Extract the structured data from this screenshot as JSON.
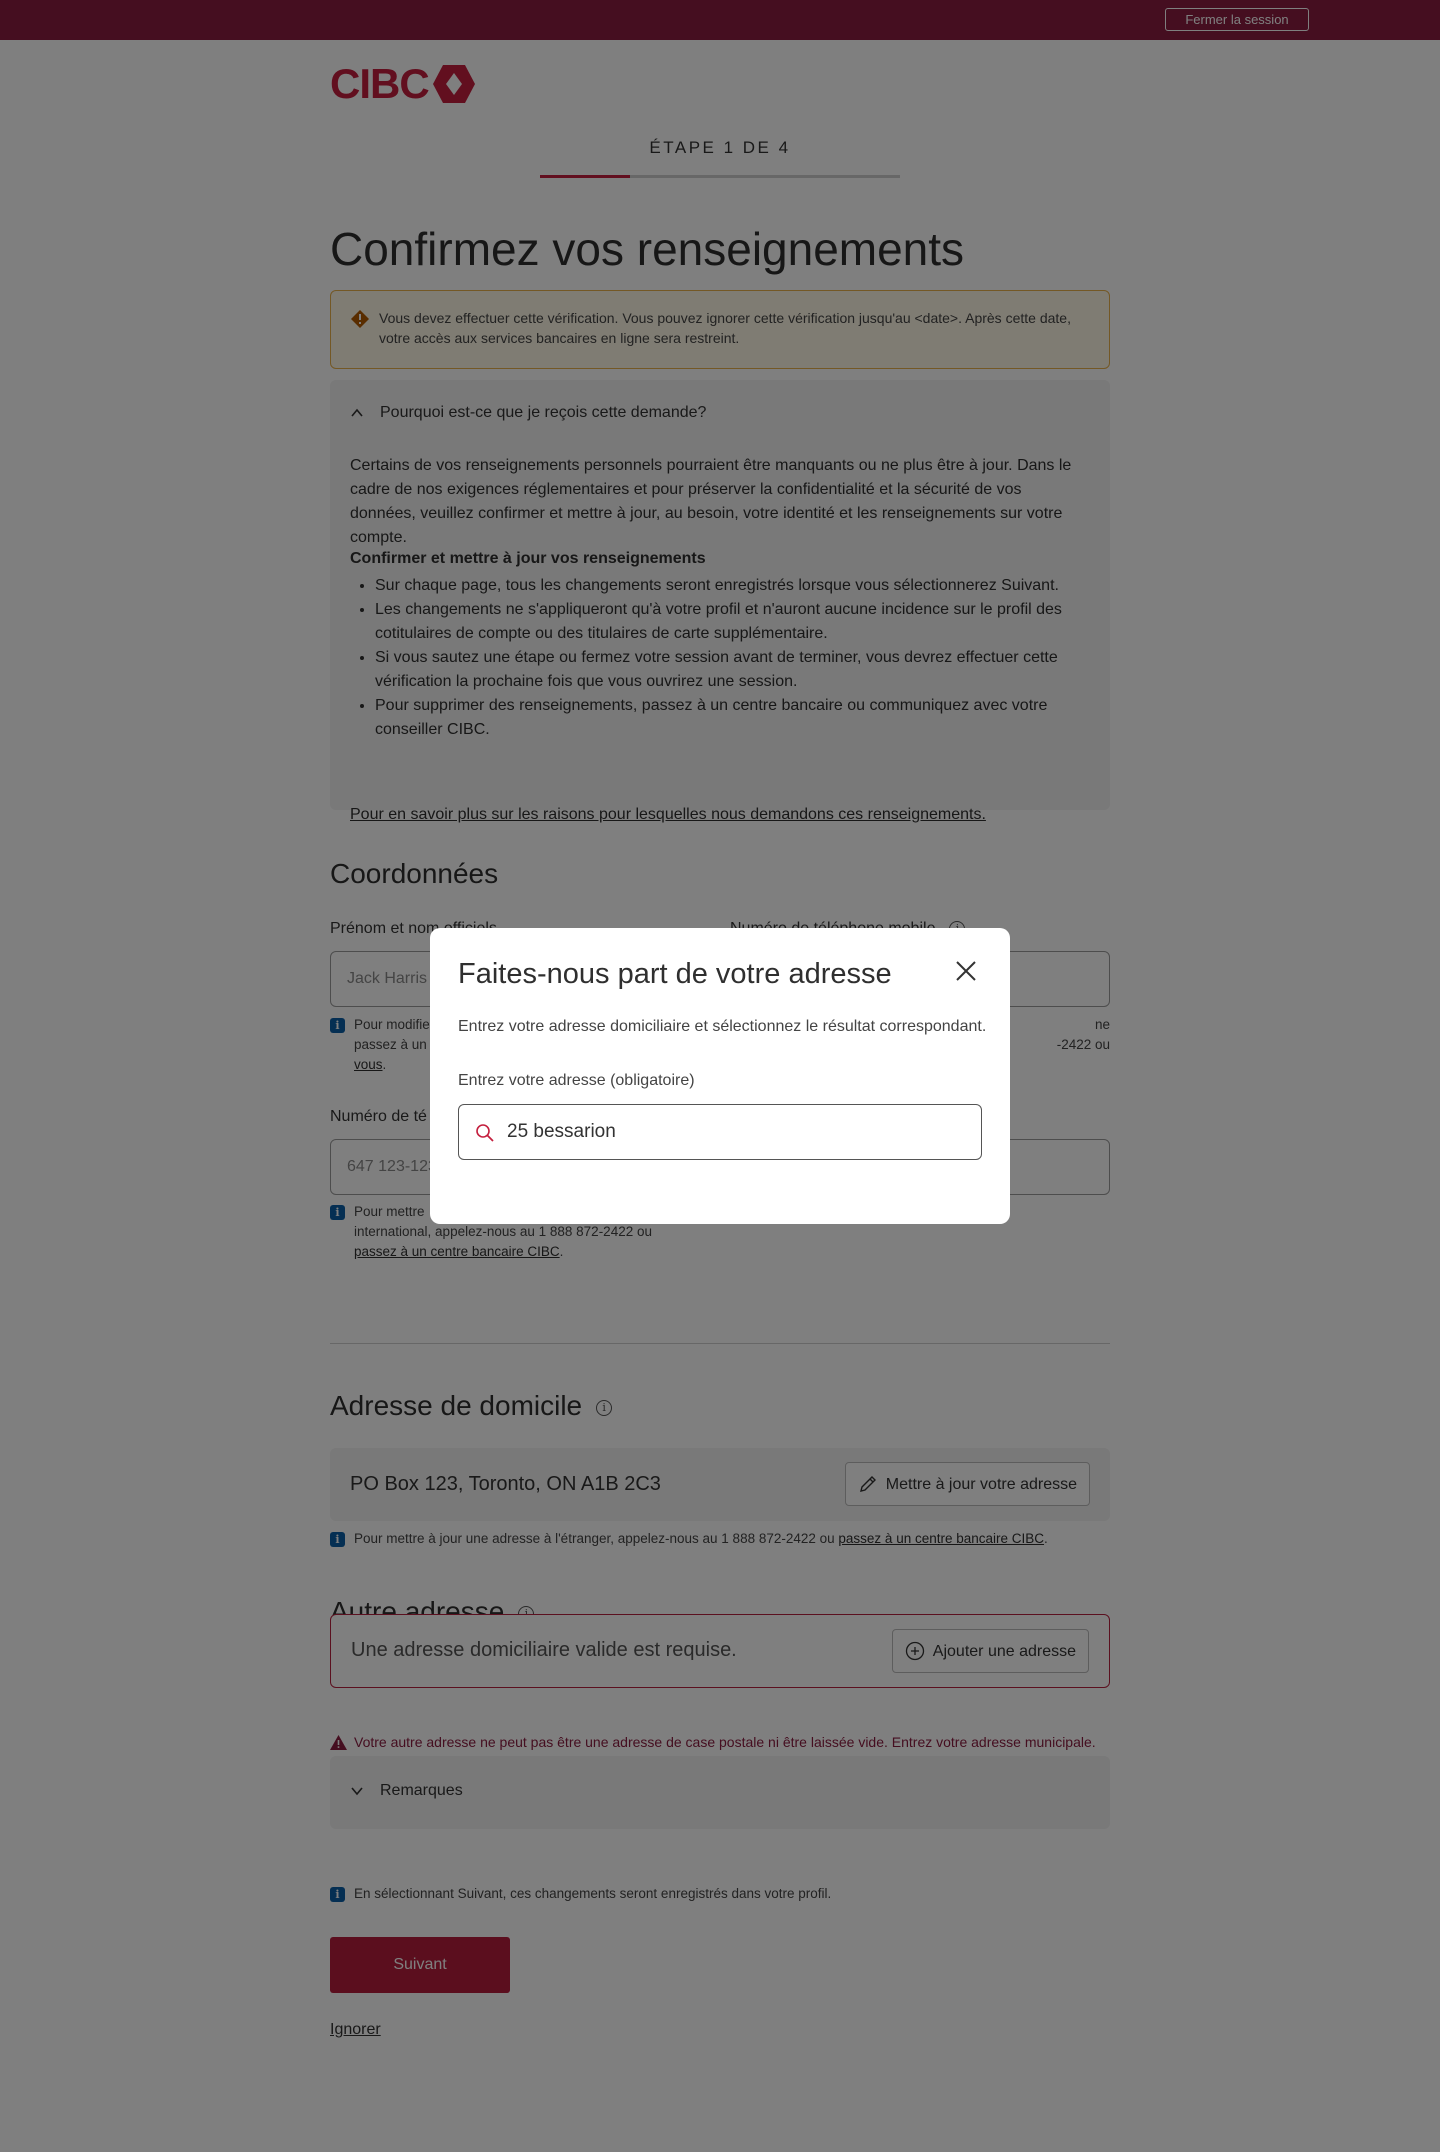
{
  "header": {
    "logout_label": "Fermer la session"
  },
  "brand": {
    "logo_text": "CIBC",
    "accent_color": "#c41f3e",
    "topbar_color": "#8b1d41"
  },
  "progress": {
    "step_label": "ÉTAPE 1 DE 4",
    "fraction": 0.25
  },
  "page": {
    "title": "Confirmez vos renseignements"
  },
  "warning": {
    "text": "Vous devez effectuer cette vérification. Vous pouvez ignorer cette vérification jusqu'au <date>. Après cette date, votre accès aux services bancaires en ligne sera restreint."
  },
  "why": {
    "heading": "Pourquoi est-ce que je reçois cette demande?",
    "paragraph": "Certains de vos renseignements personnels pourraient être manquants ou ne plus être à jour. Dans le cadre de nos exigences réglementaires et pour préserver la confidentialité et la sécurité de vos données, veuillez confirmer et mettre à jour, au besoin, votre identité et les renseignements sur votre compte.",
    "subheading": "Confirmer et mettre à jour vos renseignements",
    "bullets": [
      "Sur chaque page, tous les changements seront enregistrés lorsque vous sélectionnerez Suivant.",
      "Les changements ne s'appliqueront qu'à votre profil et n'auront aucune incidence sur le profil des cotitulaires de compte ou des titulaires de carte supplémentaire.",
      "Si vous sautez une étape ou fermez votre session avant de terminer, vous devrez effectuer cette vérification la prochaine fois que vous ouvrirez une session.",
      "Pour supprimer des renseignements, passez à un centre bancaire ou communiquez avec votre conseiller CIBC."
    ],
    "link": "Pour en savoir plus sur les raisons pour lesquelles nous demandons ces renseignements."
  },
  "contact": {
    "title": "Coordonnées",
    "name_label": "Prénom et nom officiels",
    "name_value": "Jack Harris",
    "name_help_a": "Pour modifier",
    "name_help_b": "passez à un",
    "name_help_c": "vous",
    "mobile_label": "Numéro de téléphone mobile",
    "mobile_help_a": "ne",
    "mobile_help_b": "-2422 ou",
    "phone_label": "Numéro de té",
    "phone_value": "647 123-123",
    "phone_help_a": "Pour mettre",
    "phone_help_b": "international, appelez-nous au 1 888 872-2422 ou",
    "phone_help_link": "passez à un centre bancaire CIBC"
  },
  "home_address": {
    "title": "Adresse de domicile",
    "value": "PO Box 123, Toronto, ON A1B 2C3",
    "update_button": "Mettre à jour votre adresse",
    "help_text": "Pour mettre à jour une adresse à l'étranger, appelez-nous au 1 888 872-2422 ou ",
    "help_link": "passez à un centre bancaire CIBC"
  },
  "other_address": {
    "title": "Autre adresse",
    "placeholder": "Une adresse domiciliaire valide est requise.",
    "add_button": "Ajouter une adresse",
    "error": "Votre autre adresse ne peut pas être une adresse de case postale ni être laissée vide. Entrez votre adresse municipale."
  },
  "remarks": {
    "heading": "Remarques"
  },
  "footer": {
    "save_note": "En sélectionnant Suivant, ces changements seront enregistrés dans votre profil.",
    "next_button": "Suivant",
    "skip_link": "Ignorer"
  },
  "modal": {
    "title": "Faites-nous part de votre adresse",
    "description": "Entrez votre adresse domiciliaire et sélectionnez le résultat correspondant.",
    "input_label": "Entrez votre adresse (obligatoire)",
    "input_value": "25 bessarion"
  }
}
